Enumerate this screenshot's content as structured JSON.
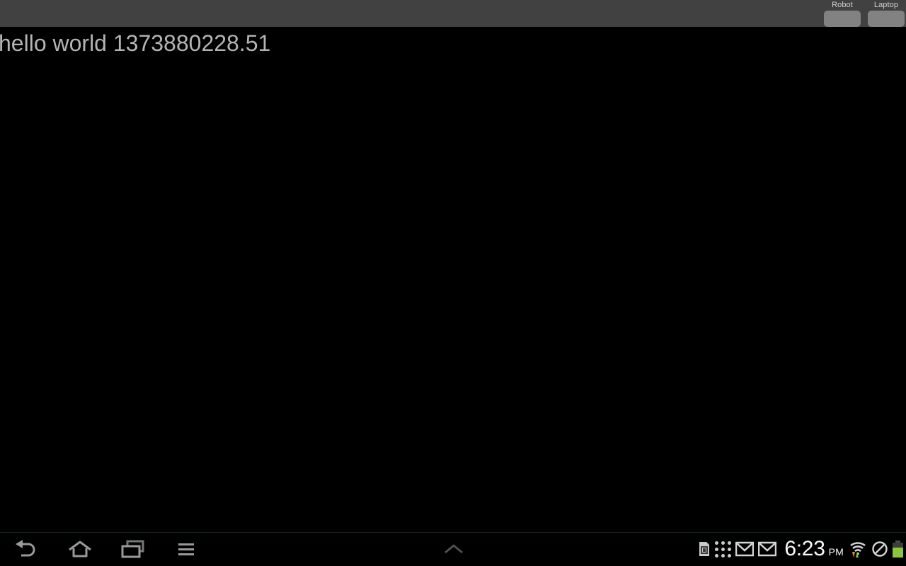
{
  "app": {
    "main_text": "hello world 1373880228.51"
  },
  "top_bar": {
    "tabs": [
      {
        "label": "Robot",
        "name": "robot"
      },
      {
        "label": "Laptop",
        "name": "laptop"
      }
    ]
  },
  "nav_bar": {
    "buttons": [
      {
        "label": "Back",
        "icon": "back-arrow-icon"
      },
      {
        "label": "Home",
        "icon": "home-icon"
      },
      {
        "label": "Recent apps",
        "icon": "recent-apps-icon"
      },
      {
        "label": "Menu",
        "icon": "menu-icon"
      }
    ],
    "center": {
      "label": "Show notifications",
      "icon": "chevron-up-icon"
    }
  },
  "status_bar": {
    "icons": [
      {
        "name": "sd-card-icon",
        "label": "SD card"
      },
      {
        "name": "app-grid-icon",
        "label": "Apps"
      },
      {
        "name": "gmail-icon",
        "label": "Gmail"
      },
      {
        "name": "gmail-icon",
        "label": "Gmail"
      }
    ],
    "clock": {
      "time": "6:23",
      "ampm": "PM"
    },
    "right_icons": [
      {
        "name": "wifi-icon",
        "label": "Wi-Fi"
      },
      {
        "name": "no-sign-icon",
        "label": "Silent / blocked"
      },
      {
        "name": "battery-icon",
        "label": "Battery"
      }
    ],
    "battery_level_percent": 68
  },
  "colors": {
    "top_bar": "#414141",
    "tab_body": "#828282",
    "text": "#b4b4b4",
    "background": "#000000",
    "battery_green": "#8cc63e",
    "nav_icon": "#9a9a9a"
  }
}
